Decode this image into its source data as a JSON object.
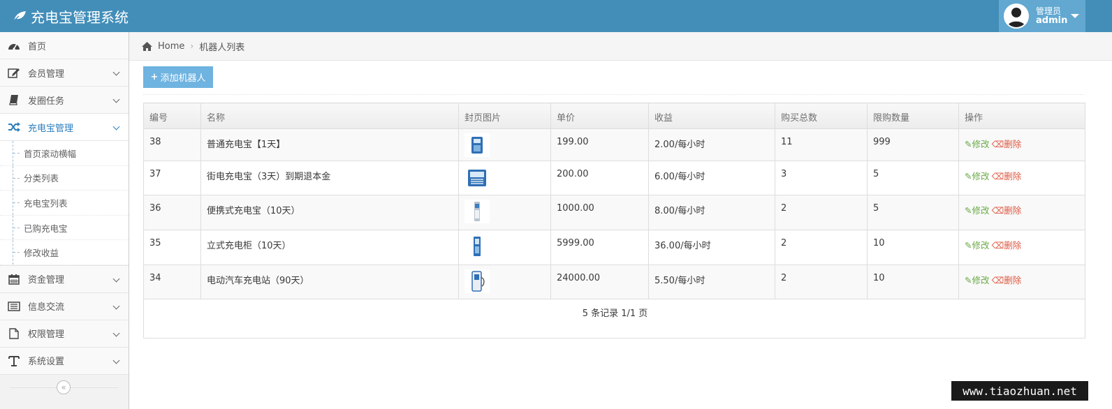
{
  "app": {
    "title": "充电宝管理系统"
  },
  "user": {
    "role": "管理员",
    "name": "admin"
  },
  "sidebar": {
    "items": [
      {
        "label": "首页",
        "icon": "dashboard-icon"
      },
      {
        "label": "会员管理",
        "icon": "edit-icon"
      },
      {
        "label": "发圈任务",
        "icon": "book-icon"
      },
      {
        "label": "充电宝管理",
        "icon": "shuffle-icon"
      },
      {
        "label": "资金管理",
        "icon": "calendar-icon"
      },
      {
        "label": "信息交流",
        "icon": "list-icon"
      },
      {
        "label": "权限管理",
        "icon": "file-icon"
      },
      {
        "label": "系统设置",
        "icon": "text-icon"
      }
    ],
    "submenu": [
      "首页滚动横幅",
      "分类列表",
      "充电宝列表",
      "已购充电宝",
      "修改收益"
    ]
  },
  "breadcrumb": {
    "home": "Home",
    "current": "机器人列表"
  },
  "toolbar": {
    "add_label": "添加机器人"
  },
  "table": {
    "headers": [
      "编号",
      "名称",
      "封页图片",
      "单价",
      "收益",
      "购买总数",
      "限购数量",
      "操作"
    ],
    "rows": [
      {
        "id": "38",
        "name": "普通充电宝【1天】",
        "price": "199.00",
        "income": "2.00/每小时",
        "total": "11",
        "limit": "999"
      },
      {
        "id": "37",
        "name": "街电充电宝（3天）到期退本金",
        "price": "200.00",
        "income": "6.00/每小时",
        "total": "3",
        "limit": "5"
      },
      {
        "id": "36",
        "name": "便携式充电宝（10天）",
        "price": "1000.00",
        "income": "8.00/每小时",
        "total": "2",
        "limit": "5"
      },
      {
        "id": "35",
        "name": "立式充电柜（10天）",
        "price": "5999.00",
        "income": "36.00/每小时",
        "total": "2",
        "limit": "10"
      },
      {
        "id": "34",
        "name": "电动汽车充电站（90天）",
        "price": "24000.00",
        "income": "5.50/每小时",
        "total": "2",
        "limit": "10"
      }
    ],
    "actions": {
      "edit": "修改",
      "delete": "删除"
    }
  },
  "pager": {
    "text": "5 条记录 1/1 页"
  },
  "watermark": "www.tiaozhuan.net",
  "colors": {
    "navbar": "#438eb9",
    "user_box": "#62a8d1",
    "add_button": "#6fb3e0",
    "edit": "#69aa46",
    "delete": "#dd5a43"
  }
}
